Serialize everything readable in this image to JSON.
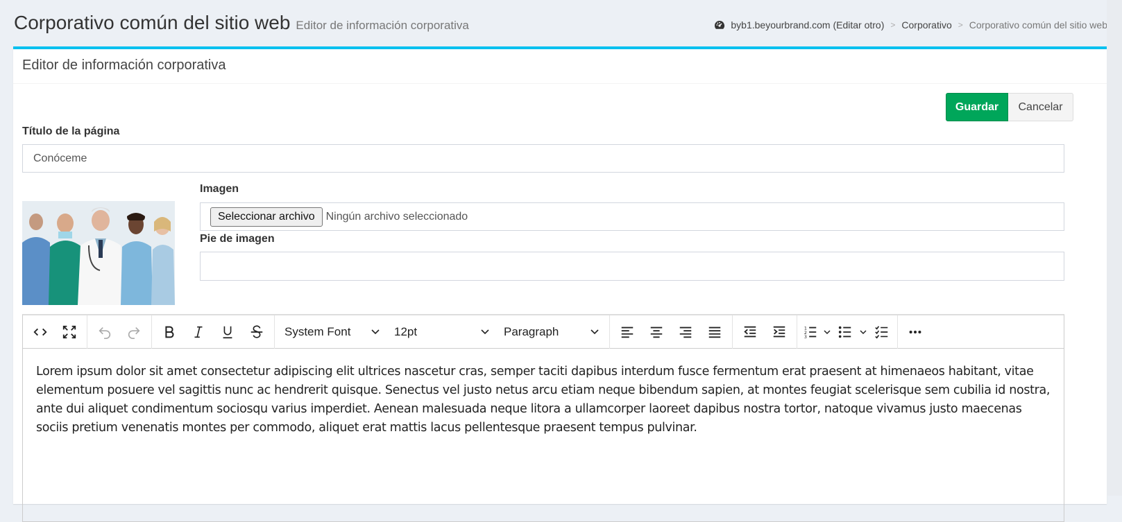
{
  "header": {
    "title": "Corporativo común del sitio web",
    "subtitle": "Editor de información corporativa"
  },
  "breadcrumb": {
    "icon": "dashboard-icon",
    "items": [
      "byb1.beyourbrand.com (Editar otro)",
      "Corporativo",
      "Corporativo común del sitio web"
    ],
    "separator": ">"
  },
  "box": {
    "title": "Editor de información corporativa",
    "accent_color": "#00c0ef"
  },
  "actions": {
    "save_label": "Guardar",
    "cancel_label": "Cancelar",
    "save_color": "#00a65a"
  },
  "form": {
    "page_title_label": "Título de la página",
    "page_title_value": "Conóceme",
    "image_label": "Imagen",
    "file_button_label": "Seleccionar archivo",
    "file_status": "Ningún archivo seleccionado",
    "caption_label": "Pie de imagen",
    "caption_value": ""
  },
  "editor": {
    "font_family": "System Font",
    "font_size": "12pt",
    "block_format": "Paragraph",
    "content": "Lorem ipsum dolor sit amet consectetur adipiscing elit ultrices nascetur cras, semper taciti dapibus interdum fusce fermentum erat praesent at himenaeos habitant, vitae elementum posuere vel sagittis nunc ac hendrerit quisque. Senectus vel justo netus arcu etiam neque bibendum sapien, at montes feugiat scelerisque sem cubilia id nostra, ante dui aliquet condimentum sociosqu varius imperdiet. Aenean malesuada neque litora a ullamcorper laoreet dapibus nostra tortor, natoque vivamus justo maecenas sociis pretium venenatis montes per commodo, aliquet erat mattis lacus pellentesque praesent tempus pulvinar."
  }
}
